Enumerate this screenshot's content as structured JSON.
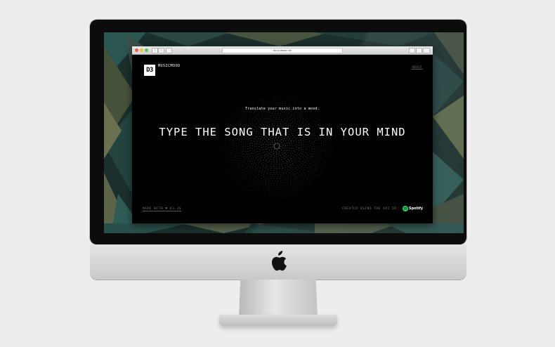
{
  "browser": {
    "url": "musicmood.me"
  },
  "site": {
    "logo_mark": "D3",
    "logo_name": "MUSICMOOD",
    "about_link": "ABOUT",
    "tagline": "Translate your music into a mood.",
    "headline": "TYPE THE SONG THAT IS IN YOUR MIND",
    "made_with": "MADE WITH ♥ D3.JS",
    "created_using": "CREATED USING THE API OF:",
    "spotify_label": "Spotify"
  },
  "colors": {
    "page_background": "#000000",
    "wall_teal": "#1f4b47",
    "wall_olive": "#5d6748",
    "spotify_green": "#1ed760",
    "close": "#ee5c54",
    "minimize": "#f5be3b",
    "maximize": "#5fc453"
  },
  "icons": {
    "apple": "apple-logo",
    "spotify": "spotify-icon"
  }
}
